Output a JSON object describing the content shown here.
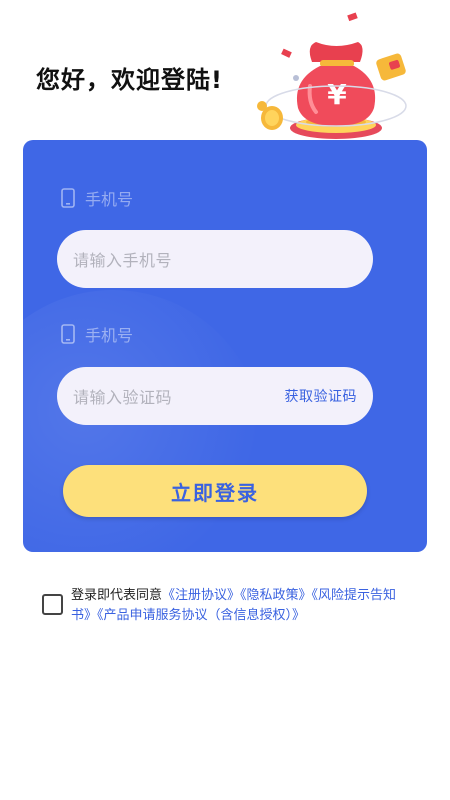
{
  "header": {
    "greeting": "您好，欢迎登陆!"
  },
  "form": {
    "phone_label": "手机号",
    "phone_placeholder": "请输入手机号",
    "code_label": "手机号",
    "code_placeholder": "请输入验证码",
    "get_code_label": "获取验证码",
    "login_label": "立即登录"
  },
  "agreement": {
    "prefix": "登录即代表同意",
    "links": [
      "《注册协议》",
      "《隐私政策》",
      "《风险提示告知书》",
      "《产品申请服务协议（含信息授权）》"
    ],
    "checked": false
  },
  "icons": [
    "phone-icon",
    "money-bag-icon",
    "coin-icon",
    "wallet-icon"
  ],
  "colors": {
    "card": "#3f67e6",
    "input_bg": "#f3f1fb",
    "button": "#fde07b",
    "accent": "#3a62e0"
  }
}
